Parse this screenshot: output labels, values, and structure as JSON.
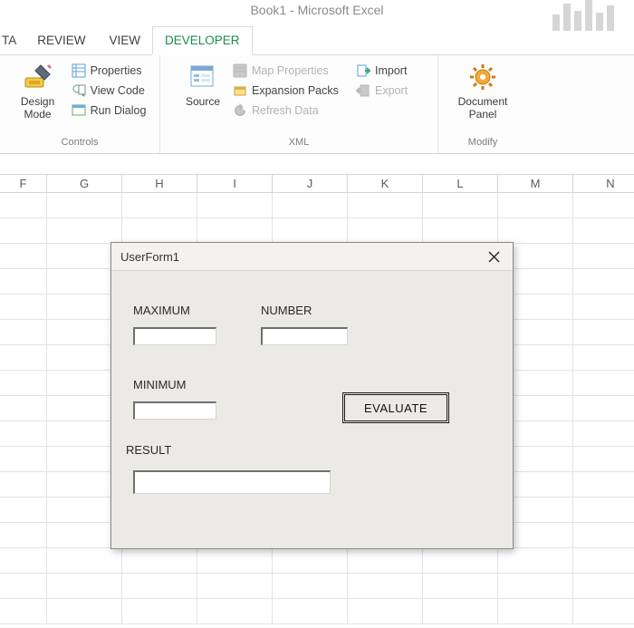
{
  "app": {
    "title": "Book1 - Microsoft Excel"
  },
  "tabs": {
    "partial": "TA",
    "review": "REVIEW",
    "view": "VIEW",
    "developer": "DEVELOPER"
  },
  "ribbon": {
    "controls": {
      "group_label": "Controls",
      "design_mode": "Design\nMode",
      "properties": "Properties",
      "view_code": "View Code",
      "run_dialog": "Run Dialog"
    },
    "xml": {
      "group_label": "XML",
      "source": "Source",
      "map_properties": "Map Properties",
      "expansion_packs": "Expansion Packs",
      "refresh_data": "Refresh Data",
      "import": "Import",
      "export": "Export"
    },
    "modify": {
      "group_label": "Modify",
      "document_panel": "Document\nPanel"
    }
  },
  "columns": [
    "F",
    "G",
    "H",
    "I",
    "J",
    "K",
    "L",
    "M",
    "N"
  ],
  "userform": {
    "title": "UserForm1",
    "lbl_maximum": "MAXIMUM",
    "lbl_number": "NUMBER",
    "lbl_minimum": "MINIMUM",
    "lbl_result": "RESULT",
    "btn_evaluate": "EVALUATE",
    "val_maximum": "",
    "val_number": "",
    "val_minimum": "",
    "val_result": ""
  }
}
